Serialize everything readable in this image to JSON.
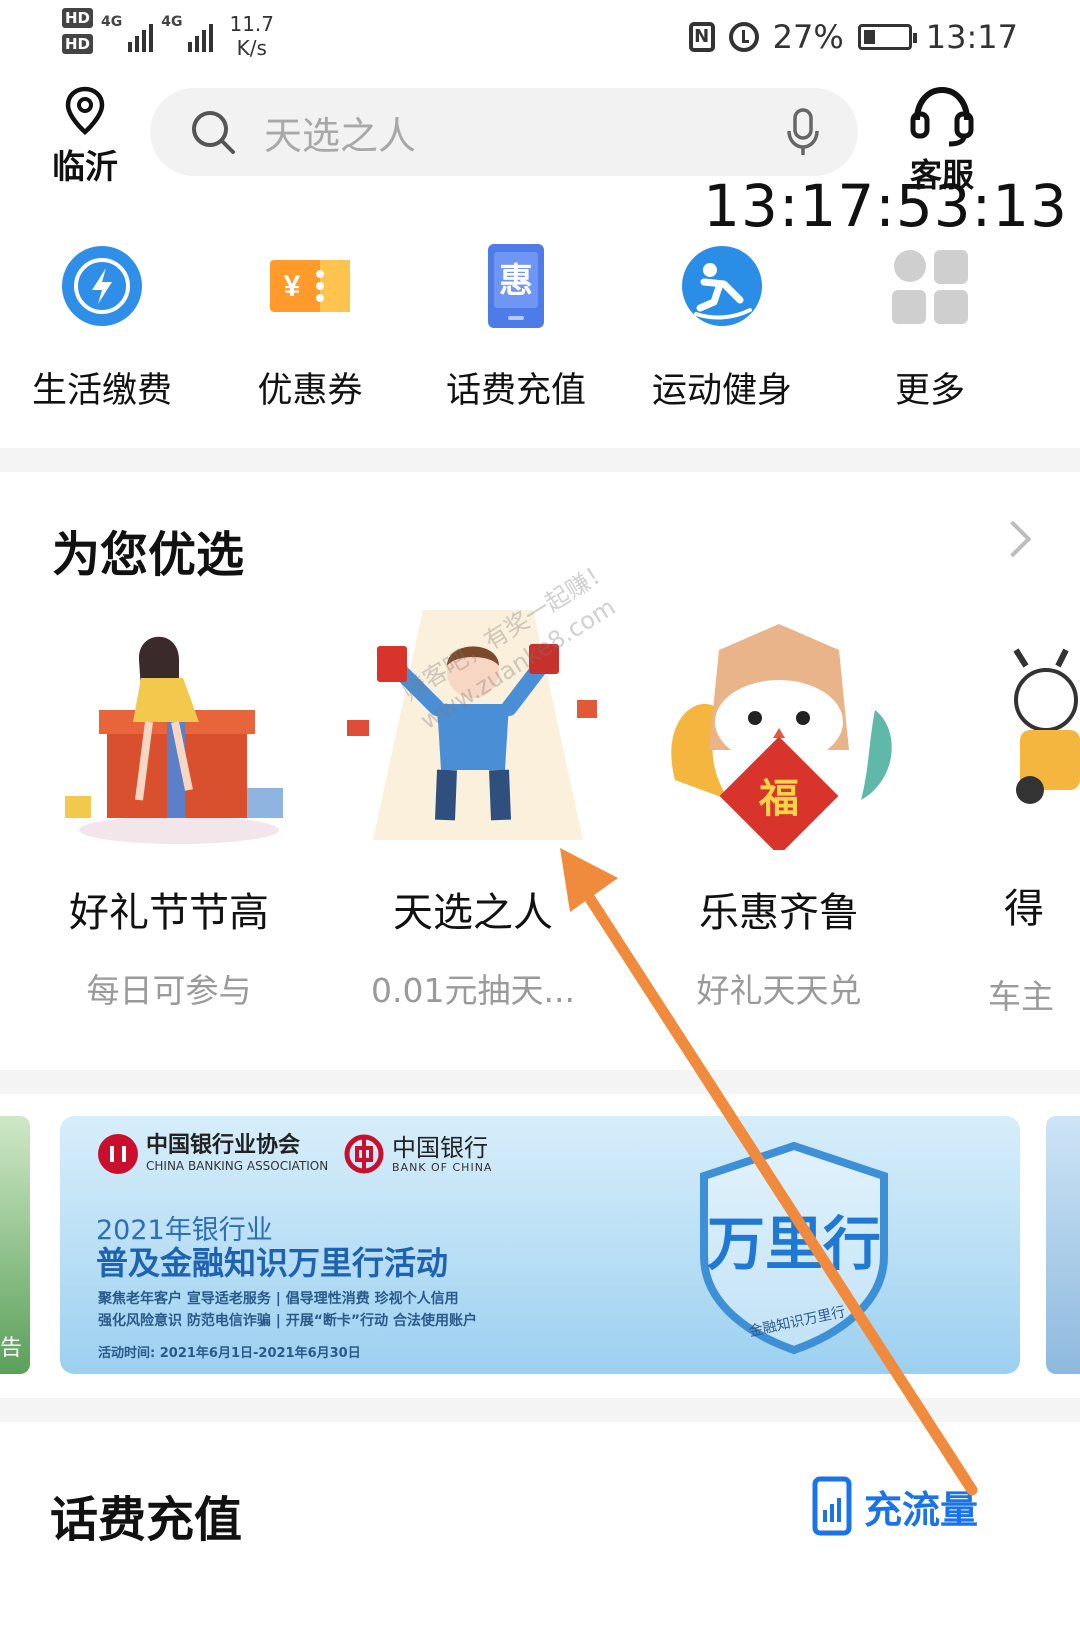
{
  "status_bar": {
    "hd1": "HD",
    "hd2": "HD",
    "network1": "4G",
    "network2": "4G",
    "speed_value": "11.7",
    "speed_unit": "K/s",
    "battery_percent": "27%",
    "battery_level": 0.27,
    "time": "13:17"
  },
  "header": {
    "location": "临沂",
    "search_placeholder": "天选之人",
    "customer_service": "客服",
    "clock_overlay": "13:17:53:13"
  },
  "services": [
    {
      "label": "生活缴费",
      "icon": "bolt-icon",
      "color": "#2f8ee8"
    },
    {
      "label": "优惠券",
      "icon": "coupon-icon",
      "color": "#ff9a2b"
    },
    {
      "label": "话费充值",
      "icon": "discount-icon",
      "color": "#4f7be8"
    },
    {
      "label": "运动健身",
      "icon": "fitness-icon",
      "color": "#2a8ee6"
    },
    {
      "label": "更多",
      "icon": "grid-icon",
      "color": "#c9c9c9"
    }
  ],
  "picks": {
    "title": "为您优选",
    "items": [
      {
        "title": "好礼节节高",
        "subtitle": "每日可参与"
      },
      {
        "title": "天选之人",
        "subtitle": "0.01元抽天..."
      },
      {
        "title": "乐惠齐鲁",
        "subtitle": "好礼天天兑",
        "badge": "福"
      },
      {
        "title": "得",
        "subtitle": "车主"
      }
    ]
  },
  "banner": {
    "org1": "中国银行业协会",
    "org1_en": "CHINA BANKING ASSOCIATION",
    "org2": "中国银行",
    "org2_en": "BANK OF CHINA",
    "year_line": "2021年银行业",
    "title": "普及金融知识万里行活动",
    "line1": "聚焦老年客户  宣导适老服务  |  倡导理性消费  珍视个人信用",
    "line2": "强化风险意识  防范电信诈骗  |  开展“断卡”行动  合法使用账户",
    "date": "活动时间:   2021年6月1日-2021年6月30日",
    "emblem_text": "万里行",
    "emblem_sub": "金融知识万里行",
    "left_card_edge": "告"
  },
  "recharge": {
    "title": "话费充值",
    "flow_label": "充流量"
  },
  "watermark": {
    "line1": "赚客吧，有奖一起赚！",
    "line2": "www.zuanke8.com"
  },
  "colors": {
    "accent": "#1a73e8",
    "arrow": "#f08a3c",
    "divider": "#f4f4f4"
  }
}
